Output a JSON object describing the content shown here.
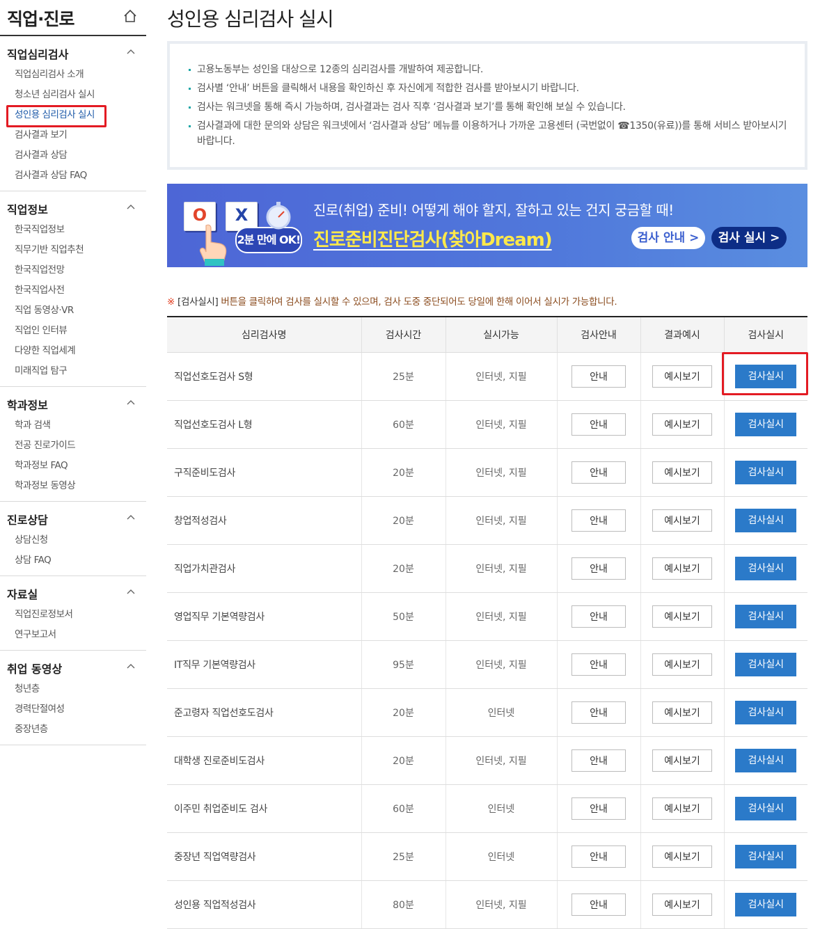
{
  "sidebar": {
    "title": "직업·진로",
    "groups": [
      {
        "title": "직업심리검사",
        "items": [
          "직업심리검사 소개",
          "청소년 심리검사 실시",
          "성인용 심리검사 실시",
          "검사결과 보기",
          "검사결과 상담",
          "검사결과 상담 FAQ"
        ]
      },
      {
        "title": "직업정보",
        "items": [
          "한국직업정보",
          "직무기반 직업추천",
          "한국직업전망",
          "한국직업사전",
          "직업 동영상·VR",
          "직업인 인터뷰",
          "다양한 직업세계",
          "미래직업 탐구"
        ]
      },
      {
        "title": "학과정보",
        "items": [
          "학과 검색",
          "전공 진로가이드",
          "학과정보 FAQ",
          "학과정보 동영상"
        ]
      },
      {
        "title": "진로상담",
        "items": [
          "상담신청",
          "상담 FAQ"
        ]
      },
      {
        "title": "자료실",
        "items": [
          "직업진로정보서",
          "연구보고서"
        ]
      },
      {
        "title": "취업 동영상",
        "items": [
          "청년층",
          "경력단절여성",
          "중장년층"
        ]
      }
    ]
  },
  "main": {
    "title": "성인용 심리검사 실시",
    "notices": [
      "고용노동부는 성인을 대상으로 12종의 심리검사를 개발하여 제공합니다.",
      "검사별 ‘안내’ 버튼을 클릭해서 내용을 확인하신 후 자신에게 적합한 검사를 받아보시기 바랍니다.",
      "검사는 워크넷을 통해 즉시 가능하며, 검사결과는 검사 직후 ‘검사결과 보기’를 통해 확인해 보실 수 있습니다.",
      "검사결과에 대한 문의와 상담은 워크넷에서 ‘검사결과 상담’ 메뉴를 이용하거나 가까운 고용센터 (국번없이 ☎1350(유료))를 통해 서비스 받아보시기 바랍니다."
    ],
    "banner": {
      "line1": "진로(취업) 준비! 어떻게 해야 할지, 잘하고 있는 건지 궁금할 때!",
      "line2": "진로준비진단검사(찾아Dream)",
      "badge": "2분 만에 OK!",
      "o_mark": "O",
      "x_mark": "X",
      "guide_button": "검사 안내 >",
      "run_button": "검사 실시 >"
    },
    "note": {
      "mark": "※",
      "button_word": "[검사실시]",
      "text": " 버튼을 클릭하여 검사를 실시할 수 있으며, 검사 도중 중단되어도 당일에 한해 이어서 실시가 가능합니다."
    },
    "table": {
      "headers": [
        "심리검사명",
        "검사시간",
        "실시가능",
        "검사안내",
        "결과예시",
        "검사실시"
      ],
      "buttons": {
        "guide": "안내",
        "example": "예시보기",
        "run": "검사실시"
      },
      "rows": [
        {
          "name": "직업선호도검사 S형",
          "time": "25분",
          "mode": "인터넷, 지필"
        },
        {
          "name": "직업선호도검사 L형",
          "time": "60분",
          "mode": "인터넷, 지필"
        },
        {
          "name": "구직준비도검사",
          "time": "20분",
          "mode": "인터넷, 지필"
        },
        {
          "name": "창업적성검사",
          "time": "20분",
          "mode": "인터넷, 지필"
        },
        {
          "name": "직업가치관검사",
          "time": "20분",
          "mode": "인터넷, 지필"
        },
        {
          "name": "영업직무 기본역량검사",
          "time": "50분",
          "mode": "인터넷, 지필"
        },
        {
          "name": "IT직무 기본역량검사",
          "time": "95분",
          "mode": "인터넷, 지필"
        },
        {
          "name": "준고령자 직업선호도검사",
          "time": "20분",
          "mode": "인터넷"
        },
        {
          "name": "대학생 진로준비도검사",
          "time": "20분",
          "mode": "인터넷, 지필"
        },
        {
          "name": "이주민 취업준비도 검사",
          "time": "60분",
          "mode": "인터넷"
        },
        {
          "name": "중장년 직업역량검사",
          "time": "25분",
          "mode": "인터넷"
        },
        {
          "name": "성인용 직업적성검사",
          "time": "80분",
          "mode": "인터넷, 지필"
        }
      ]
    }
  },
  "colors": {
    "accent": "#2b7ac9",
    "highlight": "#e31b23",
    "banner": "#4d66d6",
    "banner_title": "#ffe94a"
  }
}
